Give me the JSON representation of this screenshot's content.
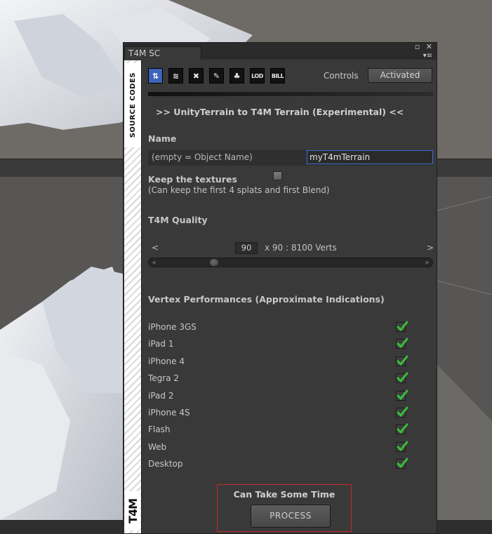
{
  "window": {
    "tab_title": "T4M SC",
    "restore_icon": "▫",
    "close_icon": "✕",
    "menu_icon": "▾≡"
  },
  "sidebar": {
    "vertical_label": "SOURCE CODES",
    "logo_text": "T4M"
  },
  "toolbar": {
    "tools": [
      {
        "icon": "terrain-converter-icon",
        "glyph": "⇅",
        "active": true
      },
      {
        "icon": "layers-icon",
        "glyph": "≋",
        "active": false
      },
      {
        "icon": "tools-icon",
        "glyph": "✖",
        "active": false
      },
      {
        "icon": "brush-icon",
        "glyph": "✎",
        "active": false
      },
      {
        "icon": "tree-icon",
        "glyph": "♣",
        "active": false
      },
      {
        "icon": "lod-icon",
        "glyph": "LOD",
        "active": false
      },
      {
        "icon": "billboard-icon",
        "glyph": "BILL",
        "active": false
      }
    ],
    "controls_label": "Controls",
    "controls_state": "Activated"
  },
  "main": {
    "heading": ">> UnityTerrain to T4M Terrain (Experimental) <<",
    "name_label": "Name",
    "name_placeholder_label": "(empty = Object Name)",
    "name_value": "myT4mTerrain",
    "keep_textures_label": "Keep the textures",
    "keep_textures_checked": false,
    "keep_textures_hint": "(Can keep the first 4 splats and first Blend)",
    "quality_label": "T4M Quality",
    "quality_prev": "<",
    "quality_next": ">",
    "quality_value": "90",
    "quality_desc": "x 90 : 8100 Verts",
    "quality_slider_fraction": 0.2,
    "vertex_heading": "Vertex Performances (Approximate Indications)",
    "devices": [
      {
        "name": "iPhone 3GS",
        "ok": true
      },
      {
        "name": "iPad 1",
        "ok": true
      },
      {
        "name": "iPhone 4",
        "ok": true
      },
      {
        "name": "Tegra 2",
        "ok": true
      },
      {
        "name": "iPad 2",
        "ok": true
      },
      {
        "name": "iPhone 4S",
        "ok": true
      },
      {
        "name": "Flash",
        "ok": true
      },
      {
        "name": "Web",
        "ok": true
      },
      {
        "name": "Desktop",
        "ok": true
      }
    ],
    "process_warning": "Can Take Some Time",
    "process_button": "PROCESS"
  },
  "colors": {
    "panel_bg": "#393939",
    "accent_blue": "#3a6cd6",
    "highlight_red": "#c22a2a",
    "check_green": "#38c038"
  }
}
